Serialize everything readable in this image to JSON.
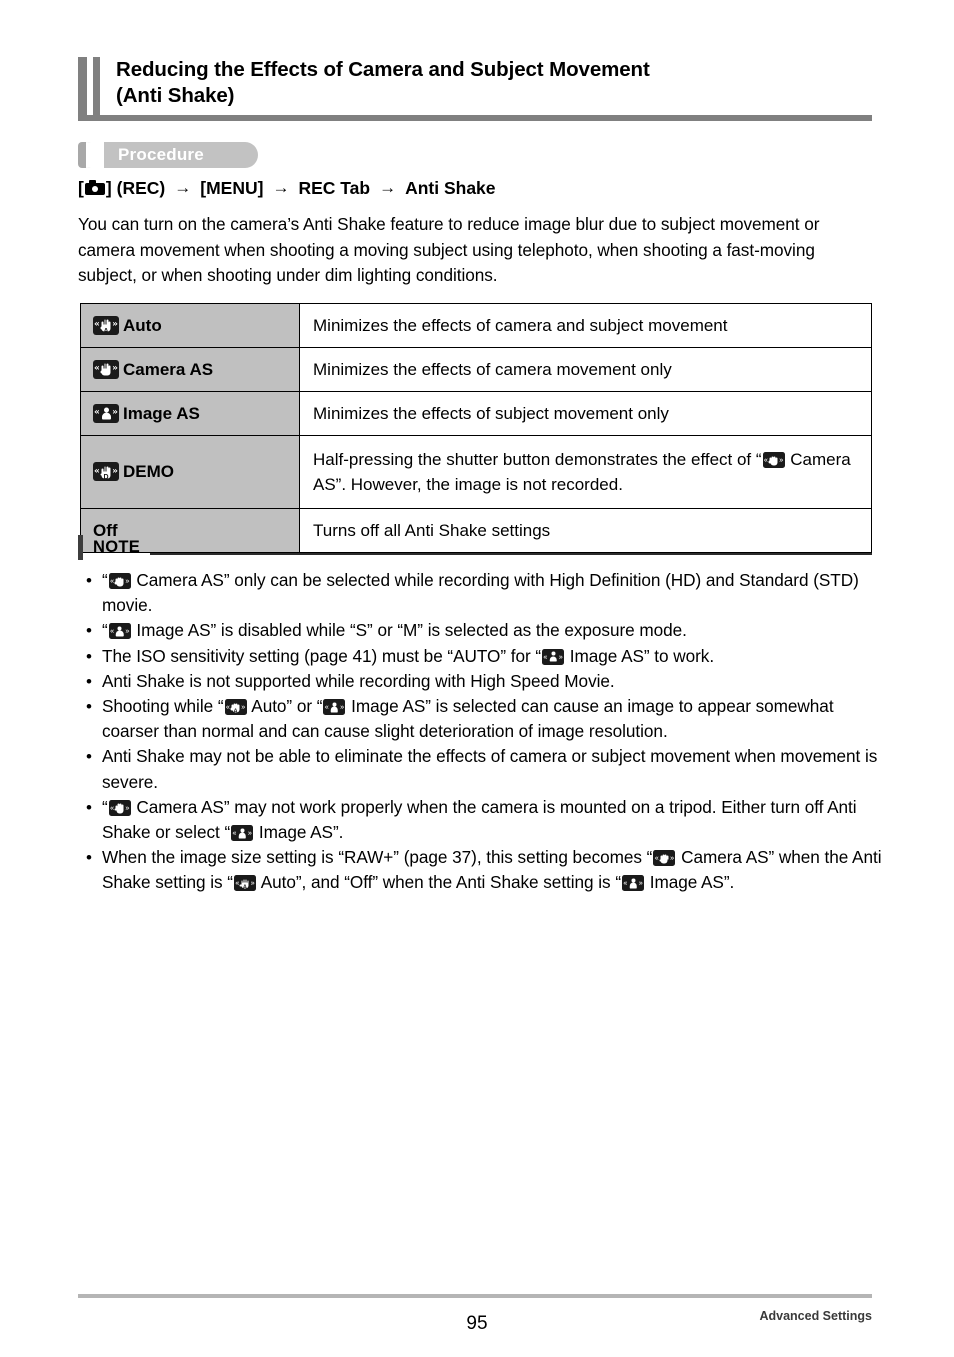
{
  "document": {
    "title_line1": "Reducing the Effects of Camera and Subject Movement",
    "title_line2": "(Anti Shake)",
    "section_badge": "Procedure"
  },
  "procedure_path": {
    "camera_icon": "camera-icon",
    "bracket_open": "[",
    "bracket_close": "]",
    "rec_label": "(REC)",
    "arrow": "→",
    "menu_label": "[MENU]",
    "tab_label": "REC Tab",
    "setting_label": "Anti Shake"
  },
  "intro_paragraph": "You can turn on the camera’s Anti Shake feature to reduce image blur due to subject movement or camera movement when shooting a moving subject using telephoto, when shooting a fast-moving subject, or when shooting under dim lighting conditions.",
  "settings_table": {
    "rows": [
      {
        "icon": "anti-shake-auto-icon",
        "icon_type": "hand-a",
        "label": "Auto",
        "description": "Minimizes the effects of camera and subject movement"
      },
      {
        "icon": "anti-shake-camera-as-icon",
        "icon_type": "hand",
        "label": "Camera AS",
        "description": "Minimizes the effects of camera movement only"
      },
      {
        "icon": "anti-shake-image-as-icon",
        "icon_type": "person",
        "label": "Image AS",
        "description": "Minimizes the effects of subject movement only"
      },
      {
        "icon": "anti-shake-demo-icon",
        "icon_type": "hand-d",
        "label": "DEMO",
        "description_part1": "Half-pressing the shutter button demonstrates the effect of “",
        "description_icon": "anti-shake-camera-as-icon",
        "description_part2": " Camera AS”. However, the image is not recorded."
      },
      {
        "icon": null,
        "icon_type": "none",
        "label": "Off",
        "description": "Turns off all Anti Shake settings"
      }
    ]
  },
  "note": {
    "heading": "NOTE",
    "bullet_char": "•",
    "items": [
      {
        "segments": [
          {
            "type": "text",
            "value": "“"
          },
          {
            "type": "icon",
            "value": "anti-shake-camera-as-icon",
            "icon_type": "hand"
          },
          {
            "type": "text",
            "value": " Camera AS” only can be selected while recording with High Definition (HD) and Standard (STD) movie."
          }
        ]
      },
      {
        "segments": [
          {
            "type": "text",
            "value": "“"
          },
          {
            "type": "icon",
            "value": "anti-shake-image-as-icon",
            "icon_type": "person"
          },
          {
            "type": "text",
            "value": " Image AS” is disabled while “S” or “M” is selected as the exposure mode."
          }
        ]
      },
      {
        "segments": [
          {
            "type": "text",
            "value": "The ISO sensitivity setting (page 41) must be “AUTO” for “"
          },
          {
            "type": "icon",
            "value": "anti-shake-image-as-icon",
            "icon_type": "person"
          },
          {
            "type": "text",
            "value": " Image AS” to work."
          }
        ]
      },
      {
        "segments": [
          {
            "type": "text",
            "value": "Anti Shake is not supported while recording with High Speed Movie."
          }
        ]
      },
      {
        "segments": [
          {
            "type": "text",
            "value": "Shooting while “"
          },
          {
            "type": "icon",
            "value": "anti-shake-auto-icon",
            "icon_type": "hand-a"
          },
          {
            "type": "text",
            "value": " Auto” or “"
          },
          {
            "type": "icon",
            "value": "anti-shake-image-as-icon",
            "icon_type": "person"
          },
          {
            "type": "text",
            "value": " Image AS” is selected can cause an image to appear somewhat coarser than normal and can cause slight deterioration of image resolution."
          }
        ]
      },
      {
        "segments": [
          {
            "type": "text",
            "value": "Anti Shake may not be able to eliminate the effects of camera or subject movement when movement is severe."
          }
        ]
      },
      {
        "segments": [
          {
            "type": "text",
            "value": "“"
          },
          {
            "type": "icon",
            "value": "anti-shake-camera-as-icon",
            "icon_type": "hand"
          },
          {
            "type": "text",
            "value": " Camera AS” may not work properly when the camera is mounted on a tripod. Either turn off Anti Shake or select “"
          },
          {
            "type": "icon",
            "value": "anti-shake-image-as-icon",
            "icon_type": "person"
          },
          {
            "type": "text",
            "value": " Image AS”."
          }
        ]
      },
      {
        "segments": [
          {
            "type": "text",
            "value": "When the image size setting is “RAW+” (page 37), this setting becomes “"
          },
          {
            "type": "icon",
            "value": "anti-shake-camera-as-icon",
            "icon_type": "hand"
          },
          {
            "type": "text",
            "value": " Camera AS” when the Anti Shake setting is “"
          },
          {
            "type": "icon",
            "value": "anti-shake-auto-icon",
            "icon_type": "hand-a"
          },
          {
            "type": "text",
            "value": " Auto”, and “Off” when the Anti Shake setting is “"
          },
          {
            "type": "icon",
            "value": "anti-shake-image-as-icon",
            "icon_type": "person"
          },
          {
            "type": "text",
            "value": " Image AS”."
          }
        ]
      }
    ]
  },
  "footer": {
    "page_number": "95",
    "chapter": "Advanced Settings"
  },
  "colors": {
    "title_bar": "#808080",
    "badge_bg": "#c2c2c2",
    "table_header_bg": "#c0c0c0",
    "note_bar": "#3d3d3d",
    "footer_rule": "#b5b5b5",
    "icon_bg": "#1a1a1a"
  }
}
